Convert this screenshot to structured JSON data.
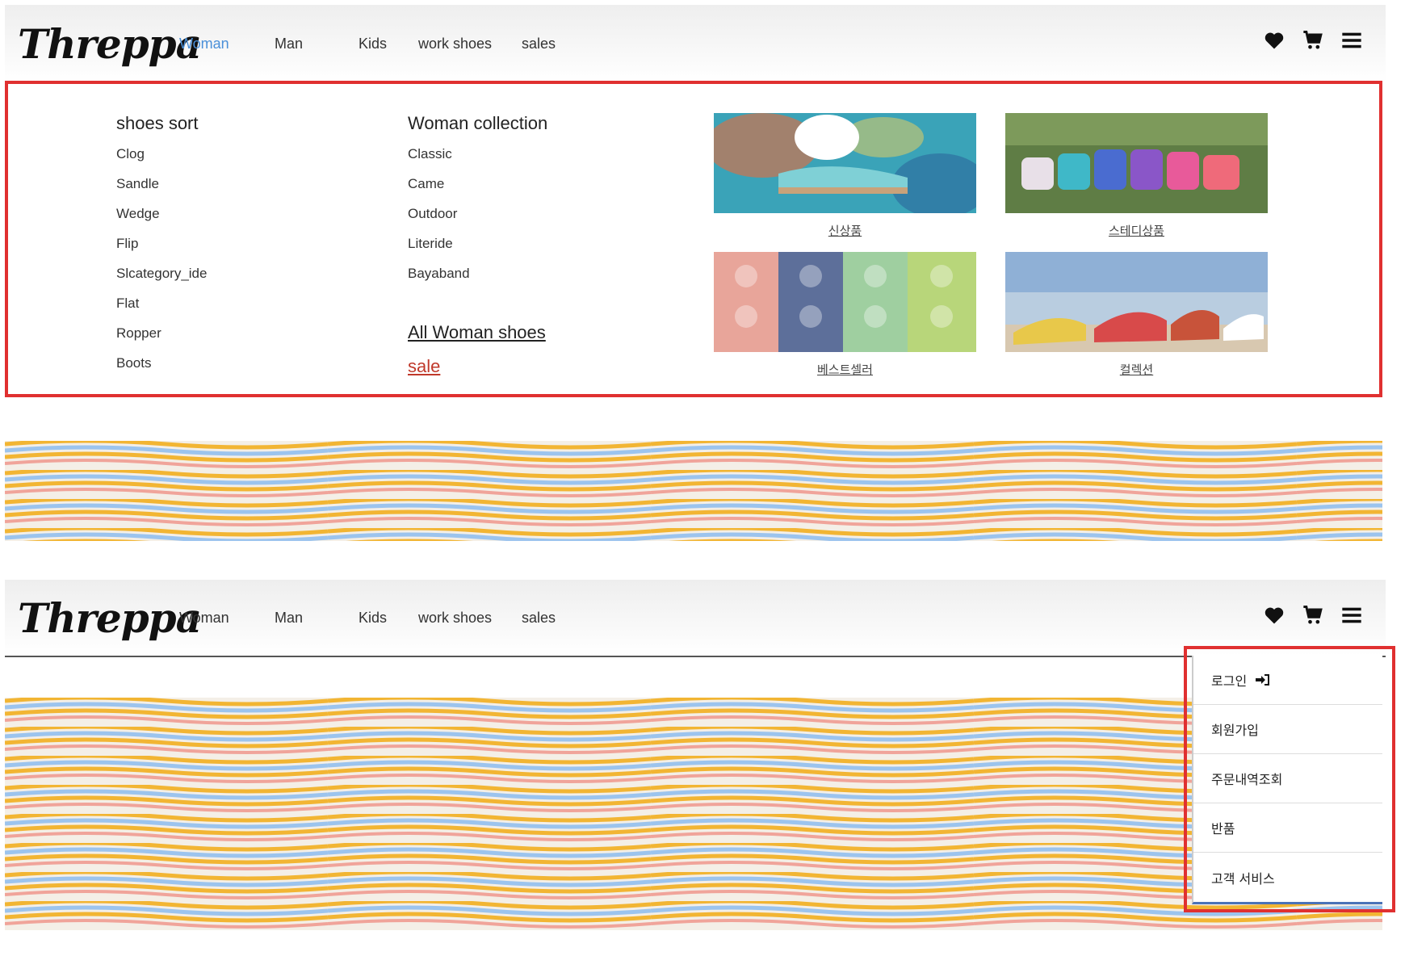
{
  "brand": {
    "logo_text": "Threppa"
  },
  "nav": {
    "items": [
      {
        "label": "Woman"
      },
      {
        "label": "Man"
      },
      {
        "label": "Kids"
      },
      {
        "label": "work shoes"
      },
      {
        "label": "sales"
      }
    ],
    "icons": [
      "heart-icon",
      "cart-icon",
      "hamburger-menu-icon"
    ]
  },
  "mega_menu": {
    "sort": {
      "title": "shoes sort",
      "links": [
        "Clog",
        "Sandle",
        "Wedge",
        "Flip",
        "Slcategory_ide",
        "Flat",
        "Ropper",
        "Boots"
      ]
    },
    "collection": {
      "title": "Woman collection",
      "links": [
        "Classic",
        "Came",
        "Outdoor",
        "Literide",
        "Bayaband"
      ],
      "all_label": "All Woman shoes",
      "sale_label": "sale"
    },
    "tiles": [
      {
        "caption": "신상품"
      },
      {
        "caption": "스테디상품"
      },
      {
        "caption": "베스트셀러"
      },
      {
        "caption": "컬렉션"
      }
    ]
  },
  "user_menu": {
    "items": [
      "로그인",
      "회원가입",
      "주문내역조회",
      "반품",
      "고객 서비스"
    ]
  },
  "colors": {
    "accent": "#4a90d9",
    "highlight_border": "#e03030",
    "sale": "#c0392b"
  }
}
